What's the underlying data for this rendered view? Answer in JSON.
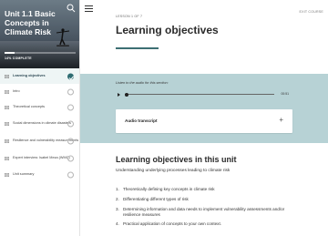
{
  "sidebar": {
    "hero_title": "Unit 1.1 Basic Concepts in Climate Risk",
    "progress_label": "14% COMPLETE",
    "progress_fraction": 0.14,
    "search_icon": "search-icon",
    "items": [
      {
        "label": "Learning objectives",
        "active": true,
        "complete": true
      },
      {
        "label": "Intro",
        "active": false,
        "complete": false
      },
      {
        "label": "Theoretical concepts",
        "active": false,
        "complete": false
      },
      {
        "label": "Social dimensions in climate disasters",
        "active": false,
        "complete": false
      },
      {
        "label": "Resilience and vulnerability measurements",
        "active": false,
        "complete": false
      },
      {
        "label": "Expert interview: Isabel Meza (WMC)",
        "active": false,
        "complete": false
      },
      {
        "label": "Unit summary",
        "active": false,
        "complete": false
      }
    ]
  },
  "header": {
    "lesson_count": "LESSON 1 OF 7",
    "exit_label": "EXIT COURSE",
    "title": "Learning objectives",
    "accent_color": "#3d6f73"
  },
  "audio": {
    "prompt": "Listen to the audio for this section:",
    "time": "00:51",
    "transcript_label": "Audio transcript",
    "band_color": "#b7d2d5"
  },
  "content": {
    "section_title": "Learning objectives in this unit",
    "subtitle": "Understanding underlying processes leading to climate risk",
    "objectives": [
      {
        "num": "1.",
        "text": "Theoretically defining key concepts in climate risk"
      },
      {
        "num": "2.",
        "text": "Differentiating different types of risk"
      },
      {
        "num": "3.",
        "text": "Determining information and data needs to implement vulnerability assessments and/or resilience measures"
      },
      {
        "num": "4.",
        "text": "Practical application of concepts to your own context."
      }
    ]
  }
}
